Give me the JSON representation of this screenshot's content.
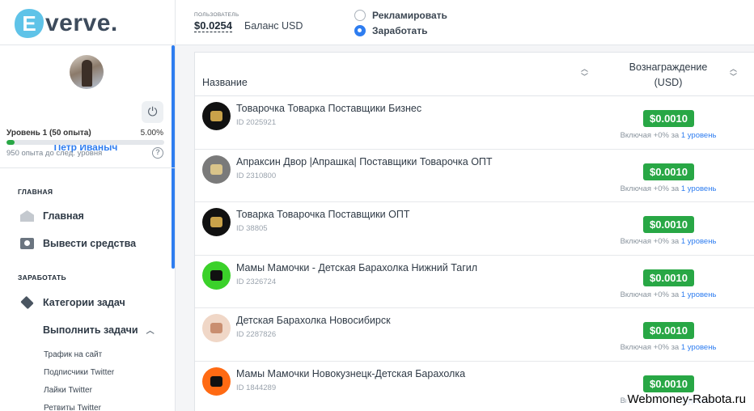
{
  "logo": {
    "text": "verve.",
    "letter": "E"
  },
  "sidebar": {
    "user_name": "Петр Иваныч",
    "level_label": "Уровень 1 (50 опыта)",
    "level_percent": "5.00%",
    "level_fraction": 0.05,
    "xp_to_next": "950 опыта до след. уровня",
    "help_symbol": "?",
    "power_symbol": "⏻",
    "section_main": "ГЛАВНАЯ",
    "item_home": "Главная",
    "item_withdraw": "Вывести средства",
    "section_earn": "ЗАРАБОТАТЬ",
    "item_categories": "Категории задач",
    "item_do_tasks": "Выполнить задачи",
    "sub_items": [
      "Трафик на сайт",
      "Подписчики Twitter",
      "Лайки Twitter",
      "Ретвиты Twitter"
    ]
  },
  "header": {
    "user_label": "ПОЛЬЗОВАТЕЛЬ",
    "balance_value": "$0.0254",
    "balance_label": "Баланс USD",
    "radio_advertise": "Рекламировать",
    "radio_earn": "Заработать",
    "selected_mode": "Заработать"
  },
  "table": {
    "col_name": "Название",
    "col_reward_line1": "Вознаграждение",
    "col_reward_line2": "(USD)",
    "rows": [
      {
        "title": "Товарочка Товарка Поставщики Бизнес",
        "id": "ID 2025921",
        "price": "$0.0010",
        "note": "Включая +0% за ",
        "note_level": "1 уровень"
      },
      {
        "title": "Апраксин Двор |Апрашка| Поставщики Товарочка ОПТ",
        "id": "ID 2310800",
        "price": "$0.0010",
        "note": "Включая +0% за ",
        "note_level": "1 уровень"
      },
      {
        "title": "Товарка Товарочка Поставщики ОПТ",
        "id": "ID 38805",
        "price": "$0.0010",
        "note": "Включая +0% за ",
        "note_level": "1 уровень"
      },
      {
        "title": "Мамы Мамочки - Детская Барахолка Нижний Тагил",
        "id": "ID 2326724",
        "price": "$0.0010",
        "note": "Включая +0% за ",
        "note_level": "1 уровень"
      },
      {
        "title": "Детская Барахолка Новосибирск",
        "id": "ID 2287826",
        "price": "$0.0010",
        "note": "Включая +0% за ",
        "note_level": "1 уровень"
      },
      {
        "title": "Мамы Мамочки Новокузнецк-Детская Барахолка",
        "id": "ID 1844289",
        "price": "$0.0010",
        "note": "Включая +0% за ",
        "note_level": "1 уровень"
      }
    ]
  },
  "watermark": "Webmoney-Rabota.ru",
  "colors": {
    "accent": "#2e7df0",
    "price_green": "#28a745"
  }
}
